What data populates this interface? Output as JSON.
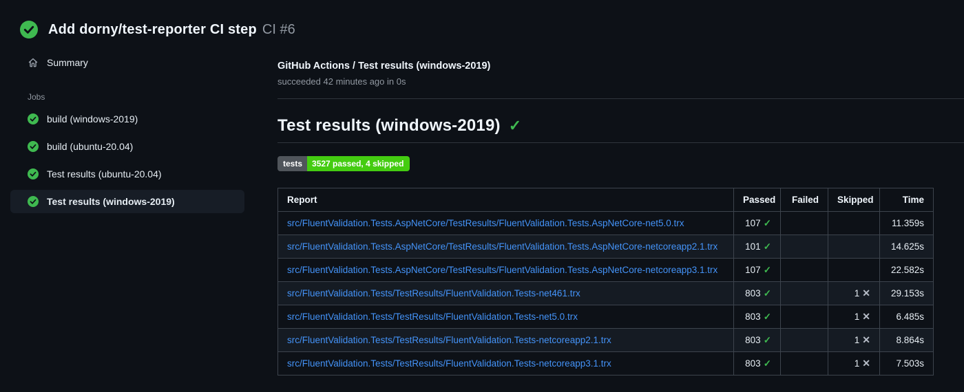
{
  "header": {
    "title": "Add dorny/test-reporter CI step",
    "run_number": "CI #6",
    "status": "success"
  },
  "sidebar": {
    "summary_label": "Summary",
    "jobs_section_label": "Jobs",
    "jobs": [
      {
        "label": "build (windows-2019)",
        "status": "success",
        "selected": false
      },
      {
        "label": "build (ubuntu-20.04)",
        "status": "success",
        "selected": false
      },
      {
        "label": "Test results (ubuntu-20.04)",
        "status": "success",
        "selected": false
      },
      {
        "label": "Test results (windows-2019)",
        "status": "success",
        "selected": true
      }
    ]
  },
  "main": {
    "check_title": "GitHub Actions / Test results (windows-2019)",
    "status_line": "succeeded 42 minutes ago in 0s",
    "section_title": "Test results (windows-2019)",
    "badge": {
      "label": "tests",
      "value": "3527 passed, 4 skipped"
    },
    "table": {
      "headers": [
        "Report",
        "Passed",
        "Failed",
        "Skipped",
        "Time"
      ],
      "rows": [
        {
          "report": "src/FluentValidation.Tests.AspNetCore/TestResults/FluentValidation.Tests.AspNetCore-net5.0.trx",
          "passed": "107",
          "failed": "",
          "skipped": "",
          "time": "11.359s"
        },
        {
          "report": "src/FluentValidation.Tests.AspNetCore/TestResults/FluentValidation.Tests.AspNetCore-netcoreapp2.1.trx",
          "passed": "101",
          "failed": "",
          "skipped": "",
          "time": "14.625s"
        },
        {
          "report": "src/FluentValidation.Tests.AspNetCore/TestResults/FluentValidation.Tests.AspNetCore-netcoreapp3.1.trx",
          "passed": "107",
          "failed": "",
          "skipped": "",
          "time": "22.582s"
        },
        {
          "report": "src/FluentValidation.Tests/TestResults/FluentValidation.Tests-net461.trx",
          "passed": "803",
          "failed": "",
          "skipped": "1",
          "time": "29.153s"
        },
        {
          "report": "src/FluentValidation.Tests/TestResults/FluentValidation.Tests-net5.0.trx",
          "passed": "803",
          "failed": "",
          "skipped": "1",
          "time": "6.485s"
        },
        {
          "report": "src/FluentValidation.Tests/TestResults/FluentValidation.Tests-netcoreapp2.1.trx",
          "passed": "803",
          "failed": "",
          "skipped": "1",
          "time": "8.864s"
        },
        {
          "report": "src/FluentValidation.Tests/TestResults/FluentValidation.Tests-netcoreapp3.1.trx",
          "passed": "803",
          "failed": "",
          "skipped": "1",
          "time": "7.503s"
        }
      ]
    }
  },
  "icons": {
    "run_status": "check-circle-icon",
    "summary": "home-icon",
    "job_status": "check-circle-icon",
    "heading_status": "check-icon",
    "passed_glyph": "✓",
    "skipped_glyph": "✕"
  },
  "colors": {
    "page_bg": "#0d1117",
    "success_green": "#3fb950",
    "link_blue": "#4493f8",
    "border": "#3d444d",
    "muted_text": "#9198a1",
    "badge_label_bg": "#50555b",
    "badge_value_bg": "#44cc11",
    "selected_row_bg": "#171d26",
    "table_stripe_bg": "#151b23"
  }
}
